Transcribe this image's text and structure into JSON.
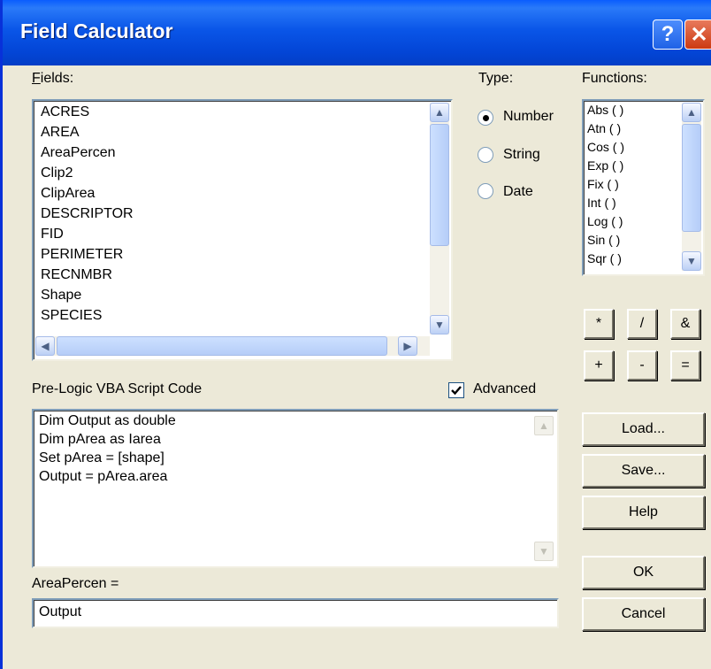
{
  "window": {
    "title": "Field Calculator",
    "help_glyph": "?",
    "close_glyph": "✕"
  },
  "fields": {
    "label": "Fields:",
    "items": [
      "ACRES",
      "AREA",
      "AreaPercen",
      "Clip2",
      "ClipArea",
      "DESCRIPTOR",
      "FID",
      "PERIMETER",
      "RECNMBR",
      "Shape",
      "SPECIES"
    ]
  },
  "type": {
    "label": "Type:",
    "options": [
      "Number",
      "String",
      "Date"
    ],
    "selected": "Number"
  },
  "functions": {
    "label": "Functions:",
    "items": [
      "Abs ( )",
      "Atn ( )",
      "Cos ( )",
      "Exp ( )",
      "Fix ( )",
      "Int ( )",
      "Log ( )",
      "Sin ( )",
      "Sqr ( )"
    ]
  },
  "operators": [
    "*",
    "/",
    "&",
    "+",
    "-",
    "="
  ],
  "script": {
    "label": "Pre-Logic VBA Script Code",
    "lines": [
      "Dim Output as double",
      "Dim pArea as Iarea",
      "Set pArea = [shape]",
      "Output = pArea.area"
    ]
  },
  "advanced": {
    "label": "Advanced",
    "checked": true
  },
  "assign": {
    "label": "AreaPercen =",
    "value": "Output"
  },
  "buttons": {
    "load": "Load...",
    "save": "Save...",
    "help": "Help",
    "ok": "OK",
    "cancel": "Cancel"
  }
}
